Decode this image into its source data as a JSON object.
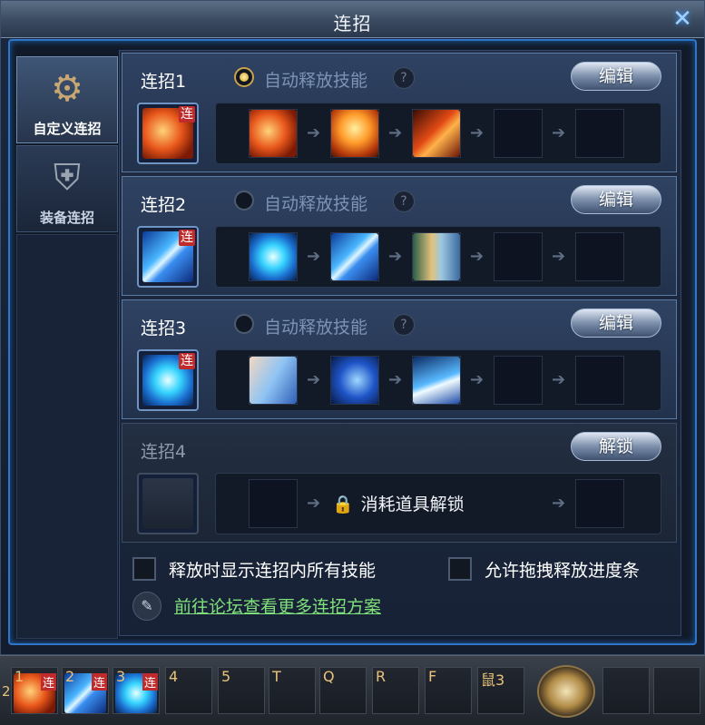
{
  "window": {
    "title": "连招",
    "close_icon": "close-x-icon"
  },
  "sidebar": {
    "tabs": [
      {
        "label": "自定义连招",
        "icon": "gear-icon",
        "active": true
      },
      {
        "label": "装备连招",
        "icon": "armor-icon",
        "active": false
      }
    ]
  },
  "combos": [
    {
      "name": "连招1",
      "auto_label": "自动释放技能",
      "help": "?",
      "auto_on": true,
      "button": "编辑",
      "main_icon": "fire-skill-icon",
      "tag": "连",
      "skills": [
        "fire-vortex-icon",
        "phoenix-icon",
        "flame-slash-icon",
        "",
        ""
      ]
    },
    {
      "name": "连招2",
      "auto_label": "自动释放技能",
      "help": "?",
      "auto_on": false,
      "button": "编辑",
      "main_icon": "lightning-skill-icon",
      "tag": "连",
      "skills": [
        "wind-vortex-icon",
        "lightning-icon",
        "fan-icon",
        "",
        ""
      ]
    },
    {
      "name": "连招3",
      "auto_label": "自动释放技能",
      "help": "?",
      "auto_on": false,
      "button": "编辑",
      "main_icon": "vortex-skill-icon",
      "tag": "连",
      "skills": [
        "face-icon",
        "ice-swirl-icon",
        "water-wave-icon",
        "",
        ""
      ]
    },
    {
      "name": "连招4",
      "locked": true,
      "button": "解锁",
      "lock_text": "消耗道具解锁",
      "main_icon": "locked-slot-icon"
    }
  ],
  "options": {
    "show_all_label": "释放时显示连招内所有技能",
    "drag_label": "允许拖拽释放进度条",
    "forum_link": "前往论坛查看更多连招方案"
  },
  "hotbar": {
    "page": "2",
    "slots": [
      {
        "key": "1",
        "icon": "fire-skill-icon",
        "tag": "连"
      },
      {
        "key": "2",
        "icon": "lightning-skill-icon",
        "tag": "连"
      },
      {
        "key": "3",
        "icon": "vortex-skill-icon",
        "tag": "连"
      },
      {
        "key": "4"
      },
      {
        "key": "5"
      },
      {
        "key": "T"
      },
      {
        "key": "Q"
      },
      {
        "key": "R"
      },
      {
        "key": "F"
      },
      {
        "key": "鼠3"
      }
    ],
    "emblem_icon": "emblem-icon"
  }
}
